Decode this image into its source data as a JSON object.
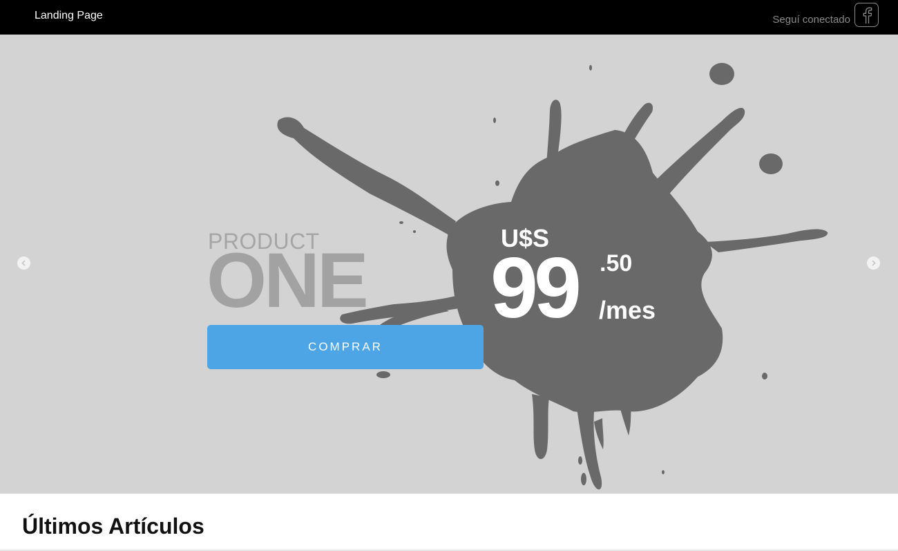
{
  "header": {
    "brand": "Landing Page",
    "social_text": "Seguí conectado",
    "social_icon": "facebook-icon"
  },
  "hero": {
    "background_color": "#d3d3d3",
    "splat_color": "#696969",
    "product_label": "PRODUCT",
    "product_name": "ONE",
    "cta_label": "COMPRAR",
    "cta_color": "#4da5e5",
    "currency": "U$S",
    "price_integer": "99",
    "price_decimal": ".50",
    "price_period": "/mes",
    "prev_icon": "chevron-left-icon",
    "next_icon": "chevron-right-icon"
  },
  "articles": {
    "title": "Últimos Artículos"
  }
}
